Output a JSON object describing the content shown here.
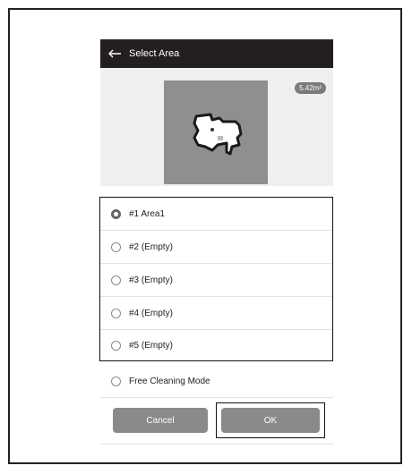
{
  "header": {
    "title": "Select Area"
  },
  "map": {
    "area_size": "5.42m²"
  },
  "areas": [
    {
      "label": "#1 Area1",
      "selected": true
    },
    {
      "label": "#2 (Empty)",
      "selected": false
    },
    {
      "label": "#3 (Empty)",
      "selected": false
    },
    {
      "label": "#4 (Empty)",
      "selected": false
    },
    {
      "label": "#5 (Empty)",
      "selected": false
    }
  ],
  "free_mode": {
    "label": "Free Cleaning Mode"
  },
  "buttons": {
    "cancel": "Cancel",
    "ok": "OK"
  }
}
